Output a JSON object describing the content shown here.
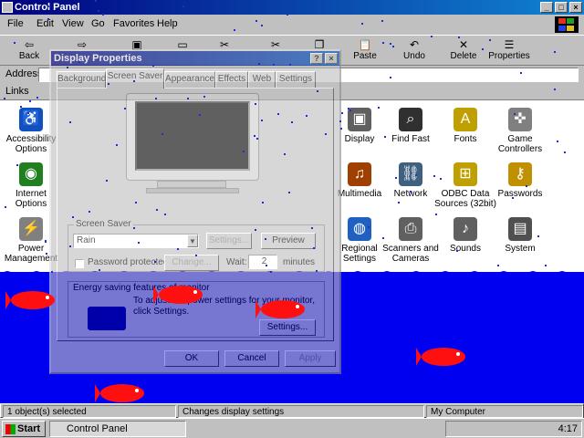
{
  "window": {
    "title": "Control Panel",
    "minimize": "_",
    "maximize": "□",
    "close": "×"
  },
  "menu": [
    "File",
    "Edit",
    "View",
    "Go",
    "Favorites",
    "Help"
  ],
  "toolbar": [
    {
      "label": "Back",
      "icon": "back-arrow-icon",
      "glyph": "⇦"
    },
    {
      "label": "",
      "icon": "forward-arrow-icon",
      "glyph": "⇨"
    },
    {
      "label": "",
      "icon": "up-folder-icon",
      "glyph": "▣"
    },
    {
      "label": "",
      "icon": "map-drive-icon",
      "glyph": "▭"
    },
    {
      "label": "",
      "icon": "disconnect-icon",
      "glyph": "✂"
    },
    {
      "label": "",
      "icon": "cut-icon",
      "glyph": "✂"
    },
    {
      "label": "",
      "icon": "copy-icon",
      "glyph": "❐"
    },
    {
      "label": "Paste",
      "icon": "paste-icon",
      "glyph": "📋"
    },
    {
      "label": "Undo",
      "icon": "undo-icon",
      "glyph": "↶"
    },
    {
      "label": "Delete",
      "icon": "delete-icon",
      "glyph": "✕"
    },
    {
      "label": "Properties",
      "icon": "properties-icon",
      "glyph": "☰"
    }
  ],
  "address": {
    "label": "Address",
    "value": ""
  },
  "links": {
    "label": "Links"
  },
  "icons": [
    {
      "label": "Accessibility Options",
      "icon": "accessibility-icon",
      "color": "#1050c0",
      "glyph": "♿"
    },
    {
      "label": "Internet Options",
      "icon": "internet-icon",
      "color": "#208020",
      "glyph": "◉"
    },
    {
      "label": "Power Management",
      "icon": "power-icon",
      "color": "#808080",
      "glyph": "⚡"
    },
    {
      "label": "Display",
      "icon": "display-icon",
      "color": "#606060",
      "glyph": "▣"
    },
    {
      "label": "Find Fast",
      "icon": "find-fast-icon",
      "color": "#303030",
      "glyph": "⌕"
    },
    {
      "label": "Fonts",
      "icon": "fonts-icon",
      "color": "#c0a000",
      "glyph": "A"
    },
    {
      "label": "Game Controllers",
      "icon": "game-controller-icon",
      "color": "#808080",
      "glyph": "✜"
    },
    {
      "label": "Multimedia",
      "icon": "multimedia-icon",
      "color": "#a04000",
      "glyph": "♫"
    },
    {
      "label": "Network",
      "icon": "network-icon",
      "color": "#406080",
      "glyph": "⛓"
    },
    {
      "label": "ODBC Data Sources (32bit)",
      "icon": "odbc-icon",
      "color": "#c0a000",
      "glyph": "⊞"
    },
    {
      "label": "Passwords",
      "icon": "passwords-icon",
      "color": "#c09000",
      "glyph": "⚷"
    },
    {
      "label": "Regional Settings",
      "icon": "regional-icon",
      "color": "#2060c0",
      "glyph": "◍"
    },
    {
      "label": "Scanners and Cameras",
      "icon": "scanner-icon",
      "color": "#606060",
      "glyph": "⎙"
    },
    {
      "label": "Sounds",
      "icon": "sounds-icon",
      "color": "#606060",
      "glyph": "♪"
    },
    {
      "label": "System",
      "icon": "system-icon",
      "color": "#505050",
      "glyph": "▤"
    }
  ],
  "status": {
    "left": "1 object(s) selected",
    "middle": "Changes display settings",
    "right": "My Computer"
  },
  "taskbar": {
    "start": "Start",
    "task": "Control Panel",
    "clock": "4:17"
  },
  "dialog": {
    "title": "Display Properties",
    "help": "?",
    "close": "×",
    "tabs": [
      "Background",
      "Screen Saver",
      "Appearance",
      "Effects",
      "Web",
      "Settings"
    ],
    "active_tab": "Screen Saver",
    "screen_saver_group": "Screen Saver",
    "screen_saver_value": "Rain",
    "settings_button": "Settings...",
    "preview_button": "Preview",
    "password_protected": "Password protected",
    "change_button": "Change...",
    "wait_label": "Wait:",
    "wait_value": "2",
    "minutes_label": "minutes",
    "energy_text_1": "Energy saving features of monitor",
    "energy_text_2": "To adjust the power settings for your monitor,",
    "energy_text_3": "click Settings.",
    "energy_settings_button": "Settings...",
    "ok_button": "OK",
    "cancel_button": "Cancel",
    "apply_button": "Apply"
  },
  "colors": {
    "ocean": "#0000f0",
    "fish": "#ff1010",
    "title": "#000080"
  }
}
